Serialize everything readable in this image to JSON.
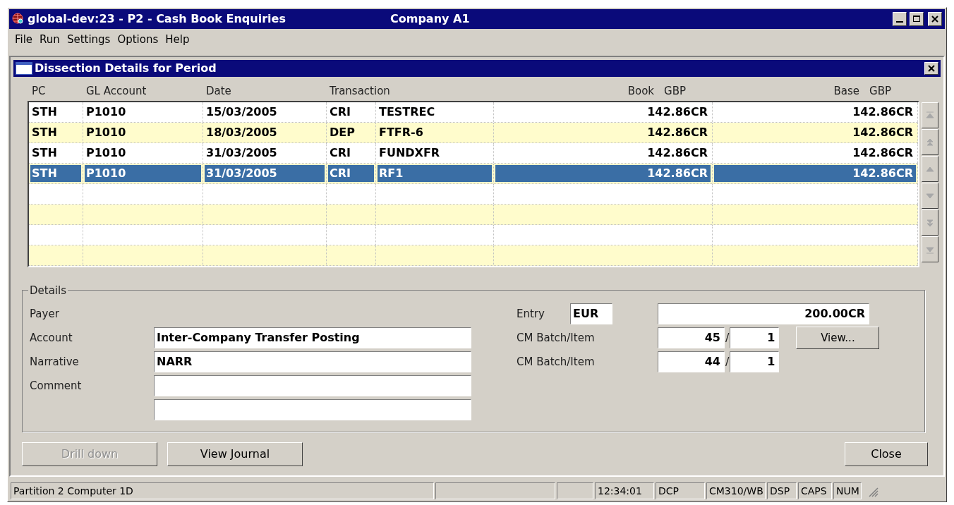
{
  "window": {
    "title": "global-dev:23 - P2 - Cash Book Enquiries",
    "company": "Company A1"
  },
  "menu": [
    "File",
    "Run",
    "Settings",
    "Options",
    "Help"
  ],
  "dialog": {
    "title": "Dissection Details for Period"
  },
  "table": {
    "columns": [
      {
        "label": "PC"
      },
      {
        "label": "GL Account"
      },
      {
        "label": "Date"
      },
      {
        "label": "Transaction"
      },
      {
        "label": "Book",
        "currency": "GBP"
      },
      {
        "label": "Base",
        "currency": "GBP"
      }
    ],
    "rows": [
      {
        "pc": "STH",
        "gl_account": "P1010",
        "date": "15/03/2005",
        "type": "CRI",
        "reference": "TESTREC",
        "book": "142.86CR",
        "base": "142.86CR",
        "selected": false
      },
      {
        "pc": "STH",
        "gl_account": "P1010",
        "date": "18/03/2005",
        "type": "DEP",
        "reference": "FTFR-6",
        "book": "142.86CR",
        "base": "142.86CR",
        "selected": false
      },
      {
        "pc": "STH",
        "gl_account": "P1010",
        "date": "31/03/2005",
        "type": "CRI",
        "reference": "FUNDXFR",
        "book": "142.86CR",
        "base": "142.86CR",
        "selected": false
      },
      {
        "pc": "STH",
        "gl_account": "P1010",
        "date": "31/03/2005",
        "type": "CRI",
        "reference": "RF1",
        "book": "142.86CR",
        "base": "142.86CR",
        "selected": true
      }
    ]
  },
  "details": {
    "title": "Details",
    "payer": {
      "label": "Payer"
    },
    "account": {
      "label": "Account",
      "value": "Inter-Company Transfer Posting"
    },
    "narrative": {
      "label": "Narrative",
      "value": "NARR"
    },
    "comment": {
      "label": "Comment"
    },
    "entry": {
      "label": "Entry",
      "currency": "EUR",
      "amount": "200.00CR"
    },
    "cm_batches": [
      {
        "label": "CM Batch/Item",
        "batch": "45",
        "separator": "/",
        "item": "1"
      },
      {
        "label": "CM Batch/Item",
        "batch": "44",
        "separator": "/",
        "item": "1"
      }
    ],
    "view_button": "View..."
  },
  "buttons": [
    {
      "label": "Drill down",
      "disabled": true
    },
    {
      "label": "View Journal",
      "disabled": false
    }
  ],
  "close_button": {
    "label": "Close",
    "disabled": false
  },
  "status_bar": {
    "message": "Partition 2 Computer 1D",
    "time": "12:34:01",
    "panels": [
      "DCP",
      "CM310/WB",
      "DSP",
      "CAPS",
      "NUM"
    ]
  }
}
